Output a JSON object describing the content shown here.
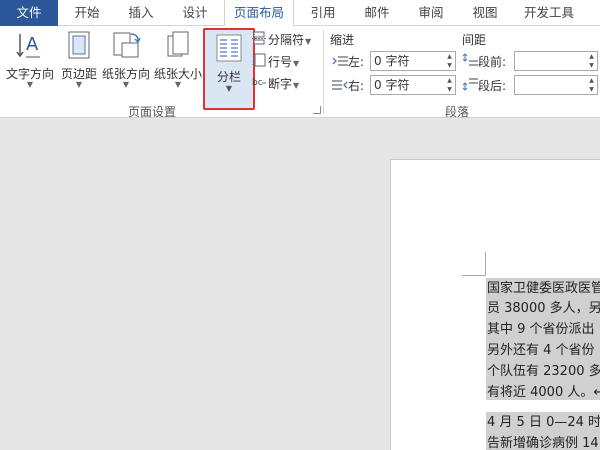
{
  "tabs": [
    {
      "label": "文件"
    },
    {
      "label": "开始"
    },
    {
      "label": "插入"
    },
    {
      "label": "设计"
    },
    {
      "label": "页面布局"
    },
    {
      "label": "引用"
    },
    {
      "label": "邮件"
    },
    {
      "label": "审阅"
    },
    {
      "label": "视图"
    },
    {
      "label": "开发工具"
    }
  ],
  "active_tab": "页面布局",
  "page_setup": {
    "text_direction": "文字方向",
    "margins": "页边距",
    "orientation": "纸张方向",
    "size": "纸张大小",
    "columns": "分栏",
    "breaks": "分隔符",
    "line_numbers": "行号",
    "hyphenation": "断字",
    "group_label": "页面设置"
  },
  "paragraph": {
    "indent_header": "缩进",
    "spacing_header": "间距",
    "left_label": "左:",
    "right_label": "右:",
    "left_value": "0 字符",
    "right_value": "0 字符",
    "before_label": "段前:",
    "after_label": "段后:",
    "group_label": "段落"
  },
  "document": {
    "lines": [
      "国家卫健委医政医管",
      "员 38000 多人，另",
      "其中 9 个省份派出",
      "另外还有 4 个省份",
      "个队伍有 23200 多",
      "有将近 4000 人。↵"
    ],
    "para2_lines": [
      "4 月 5 日 0—24 时",
      "告新增确诊病例 14"
    ]
  },
  "colors": {
    "file_tab": "#2b579a",
    "active_tab_text": "#2b579a",
    "highlight_border": "#e03030"
  }
}
